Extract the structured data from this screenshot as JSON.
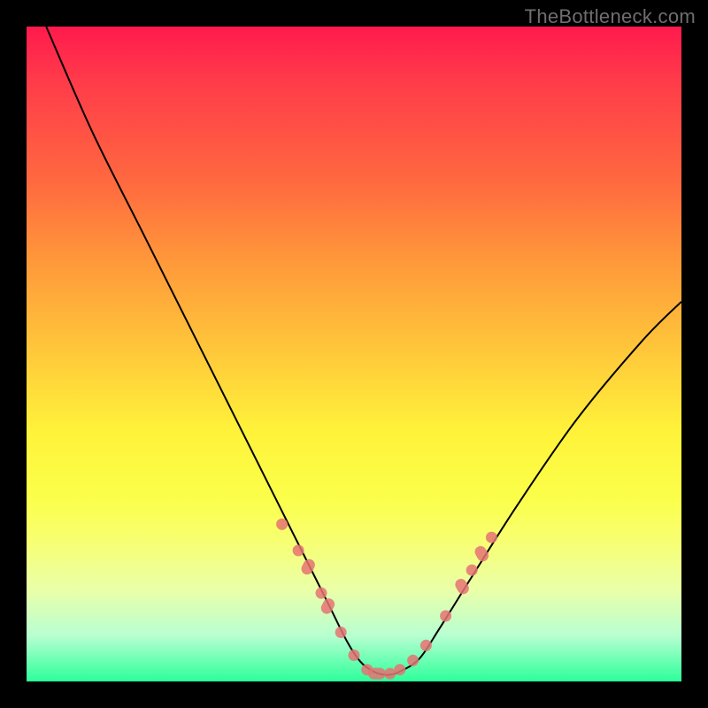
{
  "attribution": "TheBottleneck.com",
  "colors": {
    "bg": "#000000",
    "gradient_top": "#ff1a4d",
    "gradient_bottom": "#2cff9a",
    "curve": "#000000",
    "markers": "#e57373"
  },
  "chart_data": {
    "type": "line",
    "title": "",
    "xlabel": "",
    "ylabel": "",
    "xlim": [
      0,
      100
    ],
    "ylim": [
      0,
      100
    ],
    "grid": false,
    "legend": false,
    "annotations": [],
    "series": [
      {
        "name": "bottleneck-curve",
        "x": [
          3,
          10,
          18,
          26,
          33,
          38,
          42,
          46,
          49,
          51,
          53,
          55,
          57,
          60,
          63,
          68,
          75,
          84,
          94,
          100
        ],
        "y": [
          100,
          84,
          68,
          52,
          38,
          28,
          20,
          12,
          6,
          3,
          1.5,
          1,
          1.5,
          3.5,
          8,
          16,
          27,
          40,
          52,
          58
        ]
      }
    ],
    "markers": [
      {
        "x": 39.0,
        "y": 24.0,
        "type": "dot"
      },
      {
        "x": 41.5,
        "y": 20.0,
        "type": "dot"
      },
      {
        "x": 43.0,
        "y": 17.5,
        "type": "pill"
      },
      {
        "x": 45.0,
        "y": 13.5,
        "type": "dot"
      },
      {
        "x": 46.0,
        "y": 11.5,
        "type": "pill"
      },
      {
        "x": 48.0,
        "y": 7.5,
        "type": "dot"
      },
      {
        "x": 50.0,
        "y": 4.0,
        "type": "dot"
      },
      {
        "x": 52.0,
        "y": 1.8,
        "type": "dot"
      },
      {
        "x": 53.5,
        "y": 1.2,
        "type": "pillh"
      },
      {
        "x": 55.5,
        "y": 1.2,
        "type": "dot"
      },
      {
        "x": 57.0,
        "y": 1.8,
        "type": "dot"
      },
      {
        "x": 59.0,
        "y": 3.2,
        "type": "dot"
      },
      {
        "x": 61.0,
        "y": 5.5,
        "type": "dot"
      },
      {
        "x": 64.0,
        "y": 10.0,
        "type": "dot"
      },
      {
        "x": 66.5,
        "y": 14.5,
        "type": "pill"
      },
      {
        "x": 68.0,
        "y": 17.0,
        "type": "dot"
      },
      {
        "x": 69.5,
        "y": 19.5,
        "type": "pill"
      },
      {
        "x": 71.0,
        "y": 22.0,
        "type": "dot"
      }
    ]
  }
}
